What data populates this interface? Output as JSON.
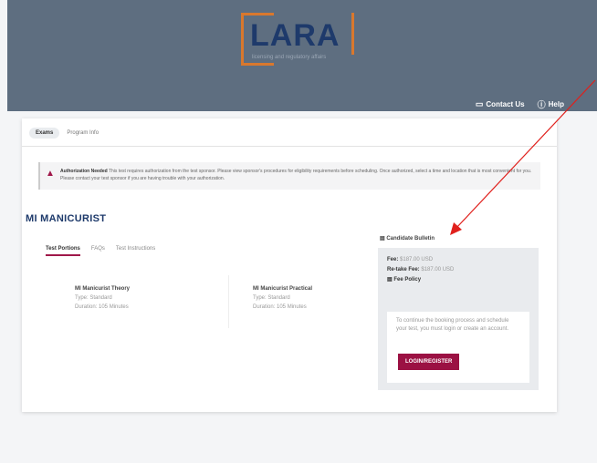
{
  "header": {
    "logo_text": "LARA",
    "logo_subtitle": "licensing and regulatory affairs",
    "contact_label": "Contact Us",
    "help_label": "Help"
  },
  "nav": {
    "tabs": [
      "Exams",
      "Program Info"
    ]
  },
  "alert": {
    "heading": "Authorization Needed",
    "body": "This test requires authorization from the test sponsor. Please view sponsor's procedures for eligibility requirements before scheduling. Once authorized, select a time and location that is most convenient for you. Please contact your test sponsor if you are having trouble with your authorization."
  },
  "exam_program": {
    "title": "MI MANICURIST",
    "sub_tabs": [
      "Test Portions",
      "FAQs",
      "Test Instructions"
    ],
    "exams": [
      {
        "name": "MI Manicurist Theory",
        "type": "Type: Standard",
        "duration": "Duration: 105 Minutes"
      },
      {
        "name": "MI Manicurist Practical",
        "type": "Type: Standard",
        "duration": "Duration: 105 Minutes"
      }
    ]
  },
  "candidate_bulletin": {
    "title": "Candidate Bulletin",
    "fee_label": "Fee:",
    "fee_value": "$187.00 USD",
    "retake_fee_label": "Re-take Fee:",
    "retake_fee_value": "$187.00 USD",
    "fee_policy": "Fee Policy",
    "inner_text": "To continue the booking process and schedule your test, you must login or create an account.",
    "login_label": "LOGIN/REGISTER"
  },
  "colors": {
    "header_bg": "#5e6e80",
    "brand_navy": "#1e3a6b",
    "logo_orange": "#d9782d",
    "accent_maroon": "#9b1143",
    "annotation_red": "#e0201c"
  }
}
